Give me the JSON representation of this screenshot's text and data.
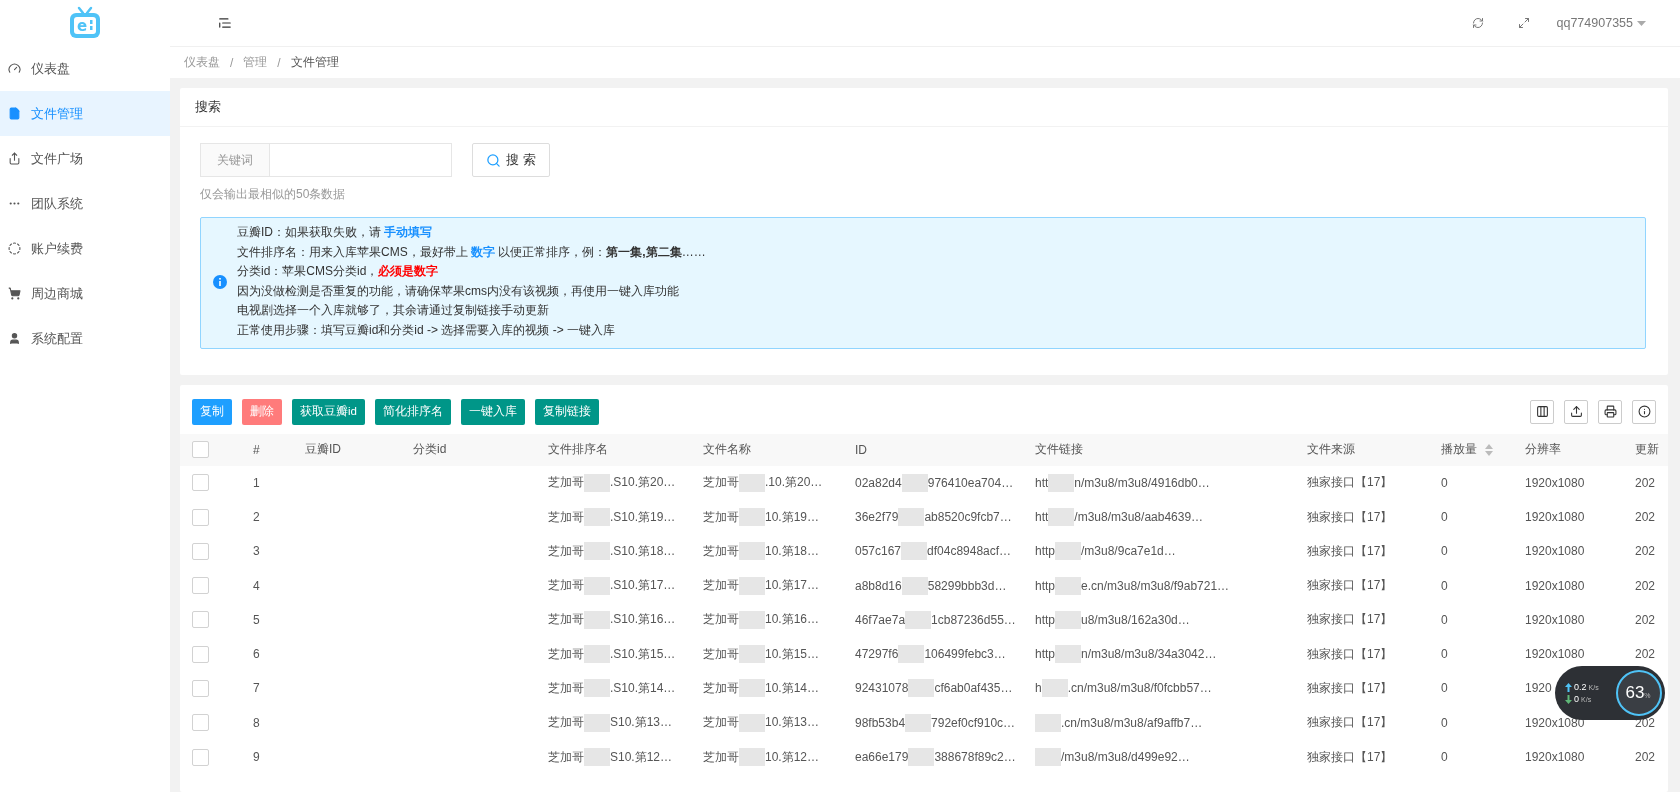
{
  "logo": {
    "letter": "e"
  },
  "sidebar": {
    "items": [
      {
        "label": "仪表盘",
        "selected": false
      },
      {
        "label": "文件管理",
        "selected": true
      },
      {
        "label": "文件广场",
        "selected": false
      },
      {
        "label": "团队系统",
        "selected": false
      },
      {
        "label": "账户续费",
        "selected": false
      },
      {
        "label": "周边商城",
        "selected": false
      },
      {
        "label": "系统配置",
        "selected": false
      }
    ]
  },
  "header": {
    "username": "qq774907355"
  },
  "breadcrumb": {
    "separator": "/",
    "items": [
      "仪表盘",
      "管理",
      "文件管理"
    ]
  },
  "search": {
    "title": "搜索",
    "field_label": "关键词",
    "button": "搜 索",
    "hint": "仅会输出最相似的50条数据"
  },
  "notice": {
    "lines": [
      [
        {
          "kind": "text",
          "text": "豆瓣ID：如果获取失败，请 "
        },
        {
          "kind": "link",
          "text": "手动填写"
        }
      ],
      [
        {
          "kind": "text",
          "text": "文件排序名：用来入库苹果CMS，最好带上 "
        },
        {
          "kind": "link",
          "text": "数字"
        },
        {
          "kind": "text",
          "text": " 以便正常排序，例：**第一集,第二集**……"
        }
      ],
      [
        {
          "kind": "text",
          "text": "分类id：苹果CMS分类id，"
        },
        {
          "kind": "danger",
          "text": "必须是数字"
        }
      ],
      [
        {
          "kind": "text",
          "text": "因为没做检测是否重复的功能，请确保苹果cms内没有该视频，再使用一键入库功能"
        }
      ],
      [
        {
          "kind": "text",
          "text": "电视剧选择一个入库就够了，其余请通过复制链接手动更新"
        }
      ],
      [
        {
          "kind": "text",
          "text": "正常使用步骤：填写豆瓣id和分类id -> 选择需要入库的视频 -> 一键入库"
        }
      ]
    ]
  },
  "toolbar": {
    "buttons": [
      {
        "label": "复制",
        "kind": "primary"
      },
      {
        "label": "删除",
        "kind": "danger"
      },
      {
        "label": "获取豆瓣id",
        "kind": "normal"
      },
      {
        "label": "简化排序名",
        "kind": "normal"
      },
      {
        "label": "一键入库",
        "kind": "normal"
      },
      {
        "label": "复制链接",
        "kind": "normal"
      }
    ]
  },
  "table": {
    "header_checked": false,
    "columns": [
      "#",
      "豆瓣ID",
      "分类id",
      "文件排序名",
      "文件名称",
      "ID",
      "文件链接",
      "文件来源",
      "播放量",
      "分辨率",
      "更新"
    ],
    "rows": [
      {
        "checked": false,
        "index": "1",
        "sort_name": {
          "before": "芝加哥",
          "after": ".S10.第20…"
        },
        "file_name": {
          "before": "芝加哥",
          "after": ".10.第20…"
        },
        "id": {
          "before": "02a82d4",
          "after": "976410ea704…"
        },
        "link": {
          "before": "htt",
          "after": "n/m3u8/m3u8/4916db0…"
        },
        "source": "独家接口【17】",
        "plays": "0",
        "resolution": "1920x1080",
        "updated": "202"
      },
      {
        "checked": false,
        "index": "2",
        "sort_name": {
          "before": "芝加哥",
          "after": ".S10.第19…"
        },
        "file_name": {
          "before": "芝加哥",
          "after": "10.第19…"
        },
        "id": {
          "before": "36e2f79",
          "after": "ab8520c9fcb7…"
        },
        "link": {
          "before": "htt",
          "after": "/m3u8/m3u8/aab4639…"
        },
        "source": "独家接口【17】",
        "plays": "0",
        "resolution": "1920x1080",
        "updated": "202"
      },
      {
        "checked": false,
        "index": "3",
        "sort_name": {
          "before": "芝加哥",
          "after": ".S10.第18…"
        },
        "file_name": {
          "before": "芝加哥",
          "after": "10.第18…"
        },
        "id": {
          "before": "057c167",
          "after": "df04c8948acf…"
        },
        "link": {
          "before": "http",
          "after": "/m3u8/9ca7e1d…"
        },
        "source": "独家接口【17】",
        "plays": "0",
        "resolution": "1920x1080",
        "updated": "202"
      },
      {
        "checked": false,
        "index": "4",
        "sort_name": {
          "before": "芝加哥",
          "after": ".S10.第17…"
        },
        "file_name": {
          "before": "芝加哥",
          "after": "10.第17…"
        },
        "id": {
          "before": "a8b8d16",
          "after": "58299bbb3d…"
        },
        "link": {
          "before": "http",
          "after": "e.cn/m3u8/m3u8/f9ab721…"
        },
        "source": "独家接口【17】",
        "plays": "0",
        "resolution": "1920x1080",
        "updated": "202"
      },
      {
        "checked": false,
        "index": "5",
        "sort_name": {
          "before": "芝加哥",
          "after": ".S10.第16…"
        },
        "file_name": {
          "before": "芝加哥",
          "after": "10.第16…"
        },
        "id": {
          "before": "46f7ae7a",
          "after": "1cb87236d55…"
        },
        "link": {
          "before": "http",
          "after": "u8/m3u8/162a30d…"
        },
        "source": "独家接口【17】",
        "plays": "0",
        "resolution": "1920x1080",
        "updated": "202"
      },
      {
        "checked": false,
        "index": "6",
        "sort_name": {
          "before": "芝加哥",
          "after": ".S10.第15…"
        },
        "file_name": {
          "before": "芝加哥",
          "after": "10.第15…"
        },
        "id": {
          "before": "47297f6",
          "after": "106499febc3…"
        },
        "link": {
          "before": "http",
          "after": "n/m3u8/m3u8/34a3042…"
        },
        "source": "独家接口【17】",
        "plays": "0",
        "resolution": "1920x1080",
        "updated": "202"
      },
      {
        "checked": false,
        "index": "7",
        "sort_name": {
          "before": "芝加哥",
          "after": ".S10.第14…"
        },
        "file_name": {
          "before": "芝加哥",
          "after": "10.第14…"
        },
        "id": {
          "before": "92431078",
          "after": "cf6ab0af435…"
        },
        "link": {
          "before": "h",
          "after": ".cn/m3u8/m3u8/f0fcbb57…"
        },
        "source": "独家接口【17】",
        "plays": "0",
        "resolution": "1920"
      },
      {
        "checked": false,
        "index": "8",
        "sort_name": {
          "before": "芝加哥",
          "after": "S10.第13…"
        },
        "file_name": {
          "before": "芝加哥",
          "after": "10.第13…"
        },
        "id": {
          "before": "98fb53b4",
          "after": "792ef0cf910c…"
        },
        "link": {
          "after": ".cn/m3u8/m3u8/af9affb7…"
        },
        "source": "独家接口【17】",
        "plays": "0",
        "resolution": "1920x1080",
        "updated": "202"
      },
      {
        "checked": false,
        "index": "9",
        "sort_name": {
          "before": "芝加哥",
          "after": "S10.第12…"
        },
        "file_name": {
          "before": "芝加哥",
          "after": "10.第12…"
        },
        "id": {
          "before": "ea66e179",
          "after": "388678f89c2…"
        },
        "link": {
          "after": "/m3u8/m3u8/d499e92…"
        },
        "source": "独家接口【17】",
        "plays": "0",
        "resolution": "1920x1080",
        "updated": "202"
      }
    ]
  },
  "speed_widget": {
    "upload": "0.2",
    "upload_unit": "K/s",
    "download": "0",
    "download_unit": "K/s",
    "percent": "63",
    "percent_unit": "%"
  }
}
